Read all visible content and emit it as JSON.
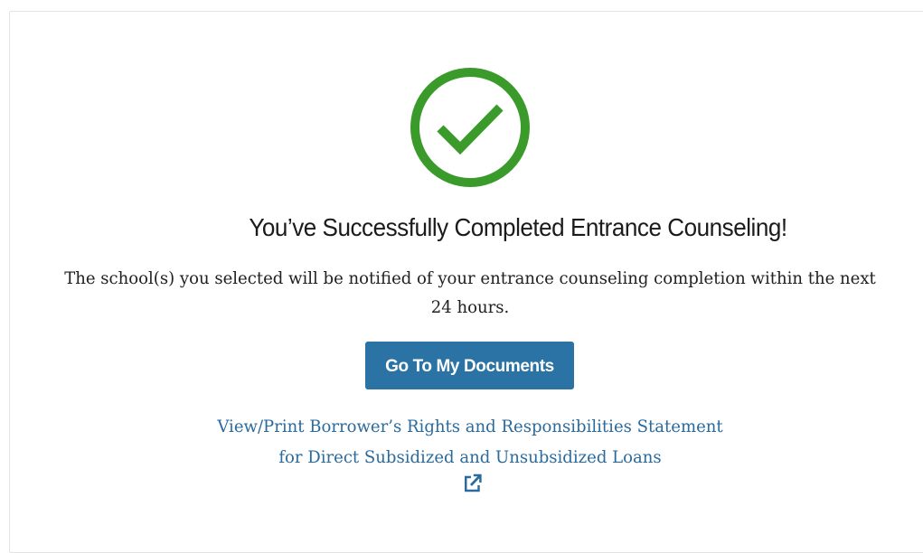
{
  "success": {
    "icon": "checkmark-circle-icon",
    "title": "You’ve Successfully Completed Entrance Counseling!",
    "message": "The school(s) you selected will be notified of your entrance counseling completion within the next 24 hours."
  },
  "actions": {
    "documents_button_label": "Go To My Documents",
    "rights_link_line1": "View/Print Borrower’s Rights and Responsibilities Statement",
    "rights_link_line2": "for Direct Subsidized and Unsubsidized Loans",
    "rights_link_icon": "external-link-icon"
  },
  "colors": {
    "success_green": "#3a9a2a",
    "button_blue": "#2b73a4",
    "link_blue": "#2b6a9c"
  }
}
